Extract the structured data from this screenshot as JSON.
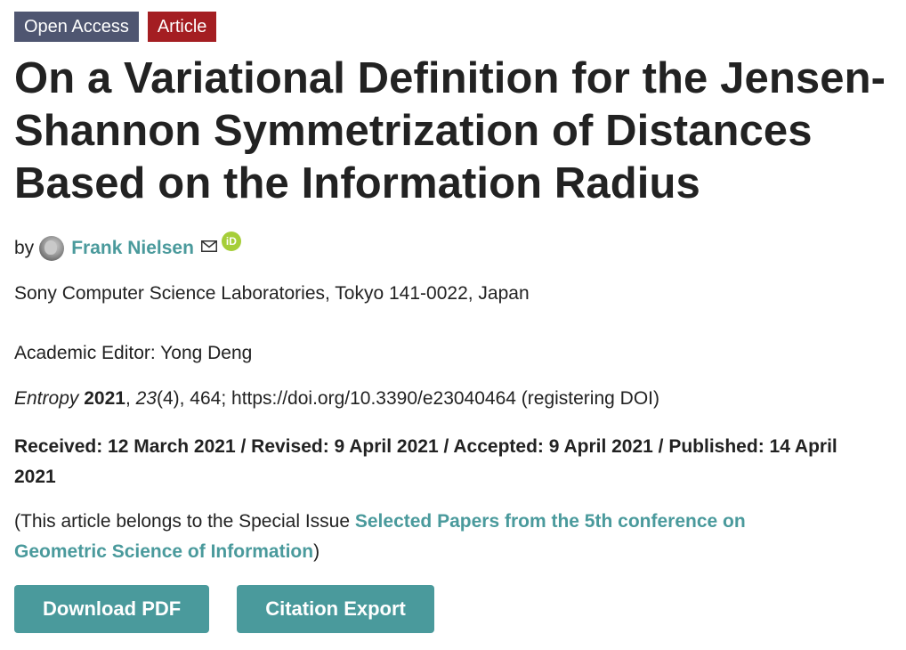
{
  "badges": {
    "open_access": "Open Access",
    "article": "Article"
  },
  "title": "On a Variational Definition for the Jensen-Shannon Symmetrization of Distances Based on the Information Radius",
  "authors": {
    "by_label": "by",
    "name": "Frank Nielsen"
  },
  "affiliation": "Sony Computer Science Laboratories, Tokyo 141-0022, Japan",
  "editor": "Academic Editor: Yong Deng",
  "citation": {
    "journal": "Entropy",
    "year": "2021",
    "volume": "23",
    "issue_pages": "(4), 464; https://doi.org/10.3390/e23040464 (registering DOI)"
  },
  "dates": "Received: 12 March 2021 / Revised: 9 April 2021 / Accepted: 9 April 2021 / Published: 14 April 2021",
  "special_issue": {
    "prefix": "(This article belongs to the Special Issue ",
    "link": "Selected Papers from the 5th conference on Geometric Science of Information",
    "suffix": ")"
  },
  "buttons": {
    "download": "Download PDF",
    "citation_export": "Citation Export"
  },
  "colors": {
    "open_access_badge": "#4f5671",
    "article_badge": "#a41e22",
    "accent": "#4a9a9c",
    "orcid": "#a6ce39"
  }
}
